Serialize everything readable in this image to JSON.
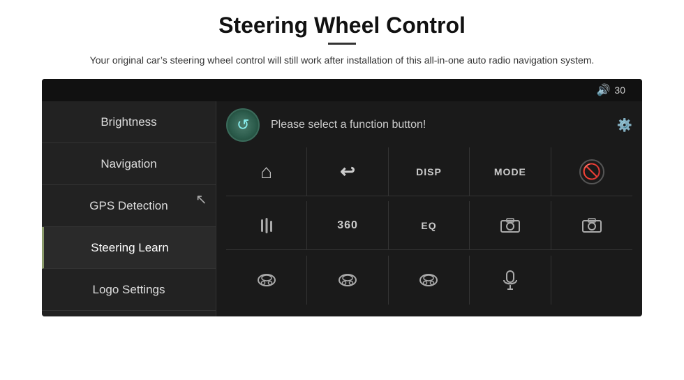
{
  "header": {
    "title": "Steering Wheel Control",
    "subtitle": "Your original car’s steering wheel control will still work after installation of this all-in-one auto radio navigation system.",
    "divider": true
  },
  "topBar": {
    "volumeIcon": "🔊",
    "volumeLevel": "30"
  },
  "sidebar": {
    "items": [
      {
        "id": "brightness",
        "label": "Brightness",
        "active": false
      },
      {
        "id": "navigation",
        "label": "Navigation",
        "active": false
      },
      {
        "id": "gps-detection",
        "label": "GPS Detection",
        "active": false
      },
      {
        "id": "steering-learn",
        "label": "Steering Learn",
        "active": true
      },
      {
        "id": "logo-settings",
        "label": "Logo Settings",
        "active": false
      }
    ]
  },
  "mainPanel": {
    "promptText": "Please select a function button!",
    "refreshIcon": "↻",
    "volumeLabel": "30"
  },
  "buttonGrid": [
    {
      "id": "cell-home",
      "type": "icon",
      "icon": "⌂",
      "label": ""
    },
    {
      "id": "cell-back",
      "type": "icon",
      "icon": "↩",
      "label": ""
    },
    {
      "id": "cell-disp",
      "type": "text",
      "icon": "",
      "label": "DISP"
    },
    {
      "id": "cell-mode",
      "type": "text",
      "icon": "",
      "label": "MODE"
    },
    {
      "id": "cell-phone",
      "type": "icon",
      "icon": "📵",
      "label": ""
    },
    {
      "id": "cell-eq-adj",
      "type": "icon",
      "icon": "⠿",
      "label": ""
    },
    {
      "id": "cell-360",
      "type": "text",
      "icon": "",
      "label": "360"
    },
    {
      "id": "cell-eq",
      "type": "text",
      "icon": "",
      "label": "EQ"
    },
    {
      "id": "cell-cam1",
      "type": "icon",
      "icon": "📷",
      "label": ""
    },
    {
      "id": "cell-cam2",
      "type": "icon",
      "icon": "📷",
      "label": ""
    },
    {
      "id": "cell-car1",
      "type": "icon",
      "icon": "🚗",
      "label": ""
    },
    {
      "id": "cell-car2",
      "type": "icon",
      "icon": "🚘",
      "label": ""
    },
    {
      "id": "cell-car3",
      "type": "icon",
      "icon": "🚖",
      "label": ""
    },
    {
      "id": "cell-mic",
      "type": "icon",
      "icon": "🎤",
      "label": ""
    },
    {
      "id": "cell-empty",
      "type": "text",
      "icon": "",
      "label": ""
    }
  ]
}
